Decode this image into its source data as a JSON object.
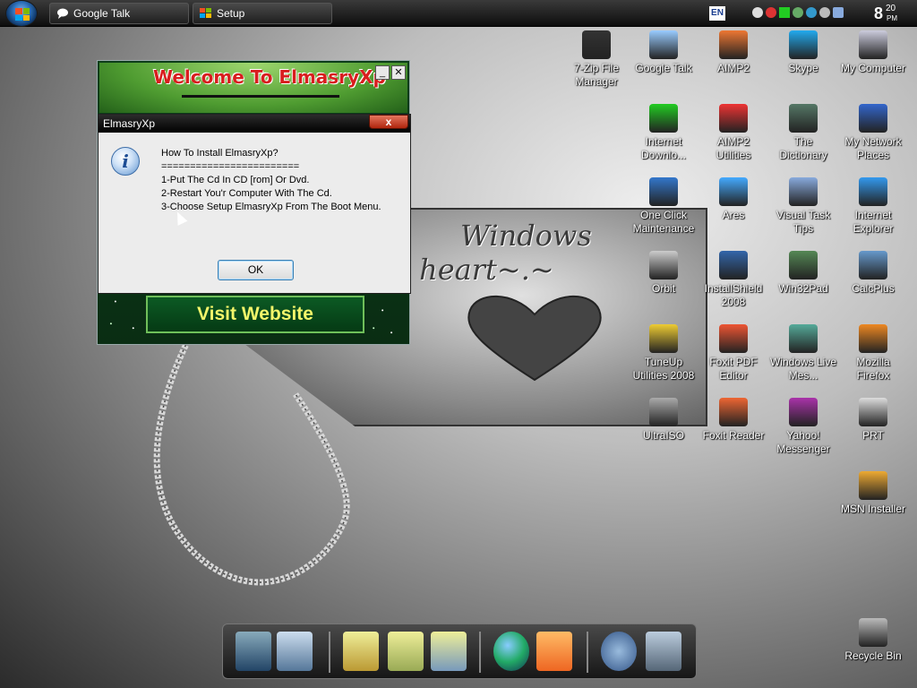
{
  "taskbar": {
    "tasks": [
      {
        "label": "Google Talk",
        "icon": "chat-bubble-icon"
      },
      {
        "label": "Setup",
        "icon": "windows-logo-icon"
      }
    ],
    "language": "EN",
    "clock": {
      "hour": "8",
      "minute": "20",
      "ampm": "PM"
    }
  },
  "desktop_icons": [
    {
      "label": "7-Zip File Manager",
      "icon": "7zip-icon"
    },
    {
      "label": "Google Talk",
      "icon": "google-talk-icon"
    },
    {
      "label": "AIMP2",
      "icon": "aimp2-icon"
    },
    {
      "label": "Skype",
      "icon": "skype-icon"
    },
    {
      "label": "My Computer",
      "icon": "computer-icon"
    },
    {
      "label": "Internet Downlo...",
      "icon": "download-manager-icon"
    },
    {
      "label": "AIMP2 Utilities",
      "icon": "aimp2-utilities-icon"
    },
    {
      "label": "The Dictionary",
      "icon": "dictionary-icon"
    },
    {
      "label": "My Network Places",
      "icon": "network-icon"
    },
    {
      "label": "One Click Maintenance",
      "icon": "maintenance-icon"
    },
    {
      "label": "Ares",
      "icon": "ares-icon"
    },
    {
      "label": "Visual Task Tips",
      "icon": "task-tips-icon"
    },
    {
      "label": "Internet Explorer",
      "icon": "internet-explorer-icon"
    },
    {
      "label": "Orbit",
      "icon": "orbit-icon"
    },
    {
      "label": "InstallShield 2008",
      "icon": "installshield-icon"
    },
    {
      "label": "Win32Pad",
      "icon": "notepad-icon"
    },
    {
      "label": "CalcPlus",
      "icon": "calculator-icon"
    },
    {
      "label": "TuneUp Utilities 2008",
      "icon": "tuneup-icon"
    },
    {
      "label": "Foxit PDF Editor",
      "icon": "foxit-editor-icon"
    },
    {
      "label": "Windows Live Mes...",
      "icon": "messenger-icon"
    },
    {
      "label": "Mozilla Firefox",
      "icon": "firefox-icon"
    },
    {
      "label": "UltraISO",
      "icon": "ultraiso-icon"
    },
    {
      "label": "Foxit Reader",
      "icon": "foxit-reader-icon"
    },
    {
      "label": "Yahoo! Messenger",
      "icon": "yahoo-messenger-icon"
    },
    {
      "label": "PRT",
      "icon": "prt-icon"
    },
    {
      "label": "MSN Installer",
      "icon": "msn-icon"
    },
    {
      "label": "Recycle Bin",
      "icon": "recycle-bin-icon"
    }
  ],
  "welcome_window": {
    "title": "Welcome To ElmasryXp",
    "minimize": "_",
    "close": "✕",
    "visit_label": "Visit Website"
  },
  "wallpaper": {
    "line1": "Windows",
    "line2": "~.~Black heart~.~"
  },
  "dialog": {
    "title": "ElmasryXp",
    "close": "x",
    "lines": [
      "How To Install ElmasryXp?",
      "========================",
      "1-Put The Cd In CD [rom] Or Dvd.",
      "",
      "2-Restart You'r Computer With The Cd.",
      "",
      "3-Choose Setup ElmasryXp From The Boot Menu."
    ],
    "ok_label": "OK"
  },
  "dock_items": [
    {
      "icon": "display-settings-icon"
    },
    {
      "icon": "computer-tools-icon"
    },
    {
      "icon": "folder-icon"
    },
    {
      "icon": "documents-folder-icon"
    },
    {
      "icon": "pictures-folder-icon"
    },
    {
      "icon": "globe-icon"
    },
    {
      "icon": "media-player-icon"
    },
    {
      "icon": "settings-gears-icon"
    },
    {
      "icon": "trash-icon"
    }
  ]
}
